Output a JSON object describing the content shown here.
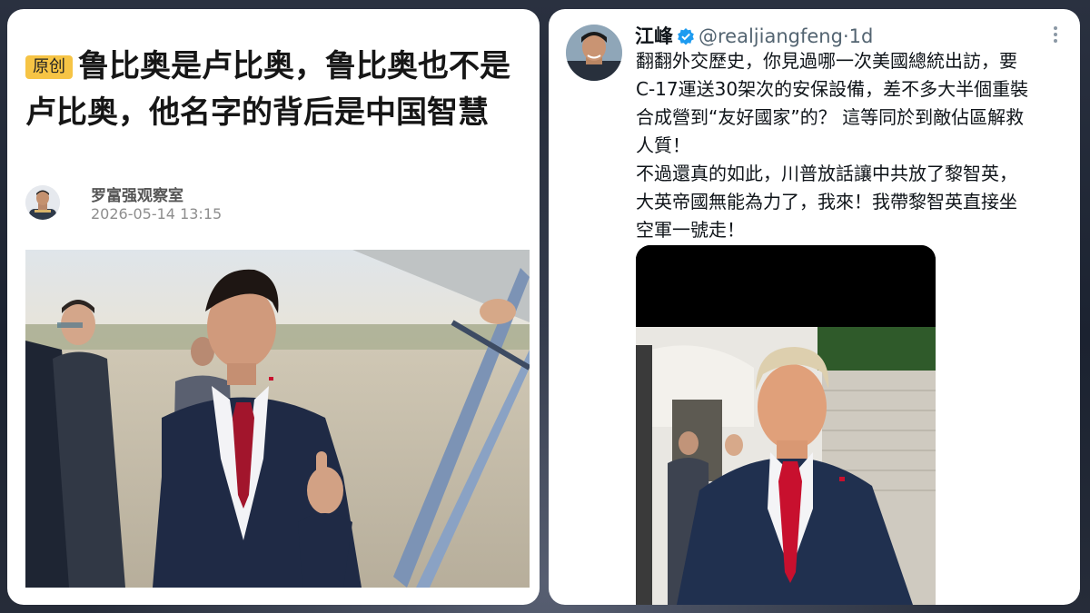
{
  "article": {
    "badge": "原创",
    "title": "鲁比奥是卢比奥，鲁比奥也不是卢比奥，他名字的背后是中国智慧",
    "author": "罗富强观察室",
    "date": "2026-05-14 13:15"
  },
  "tweet": {
    "name": "江峰",
    "handle": "@realjiangfeng",
    "separator": "·",
    "time": "1d",
    "lines": [
      "翻翻外交歷史，你見過哪一次美國總統出訪，要",
      "C-17運送30架次的安保設備，差不多大半個重裝",
      "合成營到“友好國家”的？ 這等同於到敵佔區解救",
      "人質！",
      "不過還真的如此，川普放話讓中共放了黎智英，",
      "大英帝國無能為力了，我來！我帶黎智英直接坐",
      "空軍一號走！"
    ]
  },
  "colors": {
    "badge_bg": "#f6c445",
    "verified_blue": "#1d9bf0",
    "handle_gray": "#536471",
    "card_bg": "#ffffff"
  },
  "icons": {
    "verified": "verified-badge-icon",
    "more": "more-options-icon"
  }
}
